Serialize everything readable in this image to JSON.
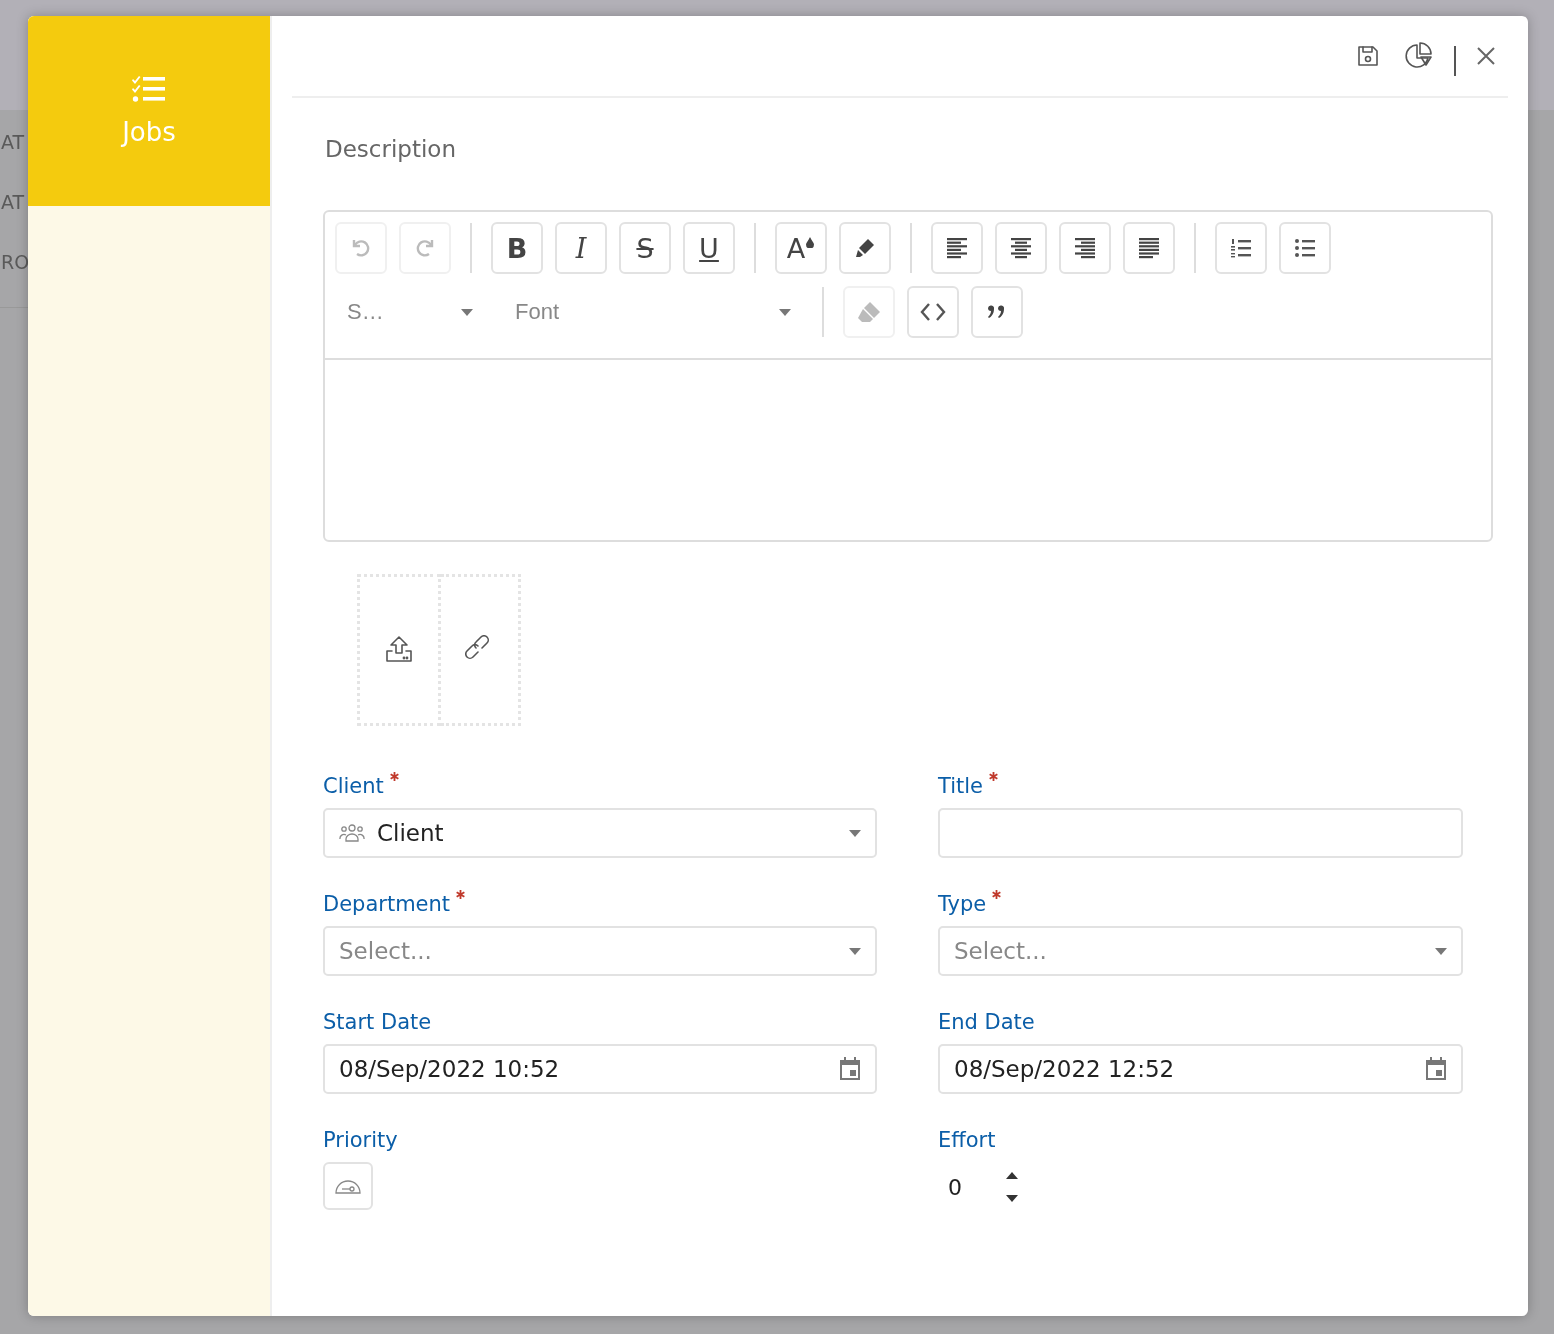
{
  "background": {
    "texts": [
      "AT",
      "AT",
      "RO"
    ]
  },
  "sidebar": {
    "title": "Jobs",
    "selected": true
  },
  "header": {
    "actions": [
      {
        "kind": "save"
      },
      {
        "kind": "chart"
      },
      {
        "kind": "close"
      }
    ]
  },
  "description": {
    "label": "Description",
    "toolbar": [
      [
        [
          {
            "kind": "undo",
            "disabled": true
          },
          {
            "kind": "redo",
            "disabled": true
          }
        ],
        [
          {
            "kind": "bold",
            "glyph": "B",
            "disabled": false
          },
          {
            "kind": "italic",
            "glyph": "I",
            "disabled": false
          },
          {
            "kind": "strike",
            "glyph": "S",
            "disabled": false
          },
          {
            "kind": "underline",
            "glyph": "U",
            "disabled": false
          }
        ],
        [
          {
            "kind": "color",
            "glyph": "A",
            "disabled": false
          },
          {
            "kind": "highlight",
            "disabled": false
          }
        ],
        [
          {
            "kind": "align-left",
            "disabled": false
          },
          {
            "kind": "align-center",
            "disabled": false
          },
          {
            "kind": "align-right",
            "disabled": false
          },
          {
            "kind": "justify",
            "disabled": false
          }
        ],
        [
          {
            "kind": "ordered-list",
            "disabled": false
          },
          {
            "kind": "bullet-list",
            "disabled": false
          }
        ]
      ],
      [
        [
          {
            "kind": "dropdown",
            "label": "S…"
          },
          {
            "kind": "dropdown",
            "label": "Font"
          }
        ],
        [
          {
            "kind": "eraser",
            "disabled": true
          },
          {
            "kind": "code",
            "disabled": false
          },
          {
            "kind": "quote",
            "disabled": false
          }
        ]
      ]
    ]
  },
  "attachments": [
    {
      "kind": "upload"
    },
    {
      "kind": "link"
    }
  ],
  "fields": [
    {
      "label": "Client",
      "required": true,
      "kind": "select",
      "value": "Client"
    },
    {
      "label": "Title",
      "required": true,
      "kind": "text"
    },
    {
      "label": "Department",
      "required": true,
      "kind": "select",
      "placeholder": "Select..."
    },
    {
      "label": "Type",
      "required": true,
      "kind": "select",
      "placeholder": "Select..."
    },
    {
      "label": "Start Date",
      "required": false,
      "kind": "date",
      "value": "08/Sep/2022 10:52"
    },
    {
      "label": "End Date",
      "required": false,
      "kind": "date",
      "value": "08/Sep/2022 12:52"
    },
    {
      "label": "Priority",
      "required": false,
      "kind": "priority"
    },
    {
      "label": "Effort",
      "required": false,
      "kind": "number",
      "value": "0"
    }
  ]
}
